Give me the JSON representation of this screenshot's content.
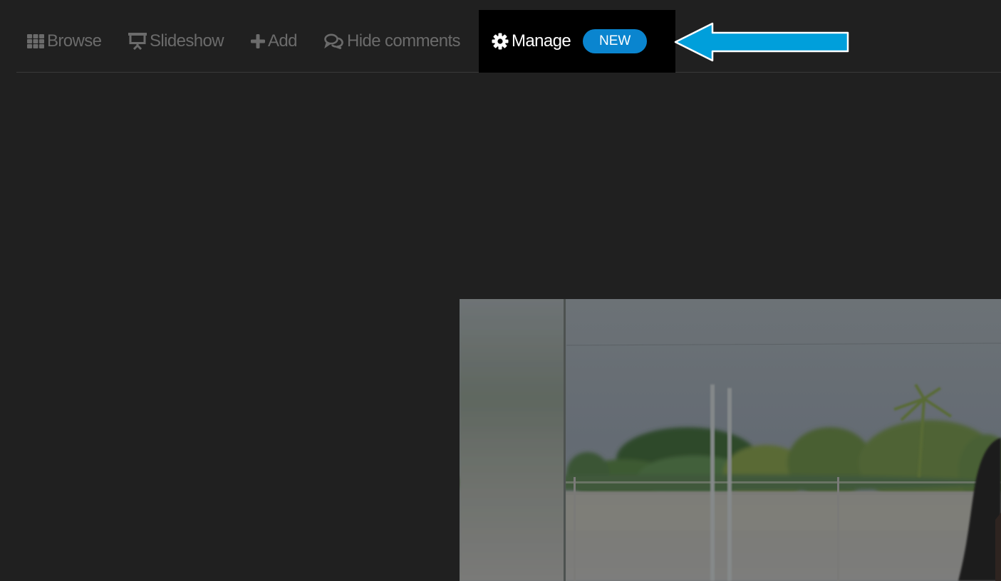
{
  "nav": {
    "items": [
      {
        "id": "browse",
        "label": "Browse",
        "icon": "grid-icon"
      },
      {
        "id": "slideshow",
        "label": "Slideshow",
        "icon": "presentation-icon"
      },
      {
        "id": "add",
        "label": "Add",
        "icon": "plus-icon"
      },
      {
        "id": "hide_comments",
        "label": "Hide comments",
        "icon": "comments-icon"
      },
      {
        "id": "manage",
        "label": "Manage",
        "icon": "gear-icon",
        "active": true,
        "badge": "NEW"
      }
    ]
  },
  "annotation": {
    "arrow": "left-arrow-icon",
    "color": "#009fdb"
  },
  "colors": {
    "background": "#202020",
    "nav_text": "#6b6b6b",
    "active_bg": "#000000",
    "active_text": "#ffffff",
    "badge_bg": "#0a85cf"
  },
  "photo": {
    "description": "Outdoor photo: cloudy sky, trees and palm, white wall, poles, woman with dark hair at right edge"
  }
}
